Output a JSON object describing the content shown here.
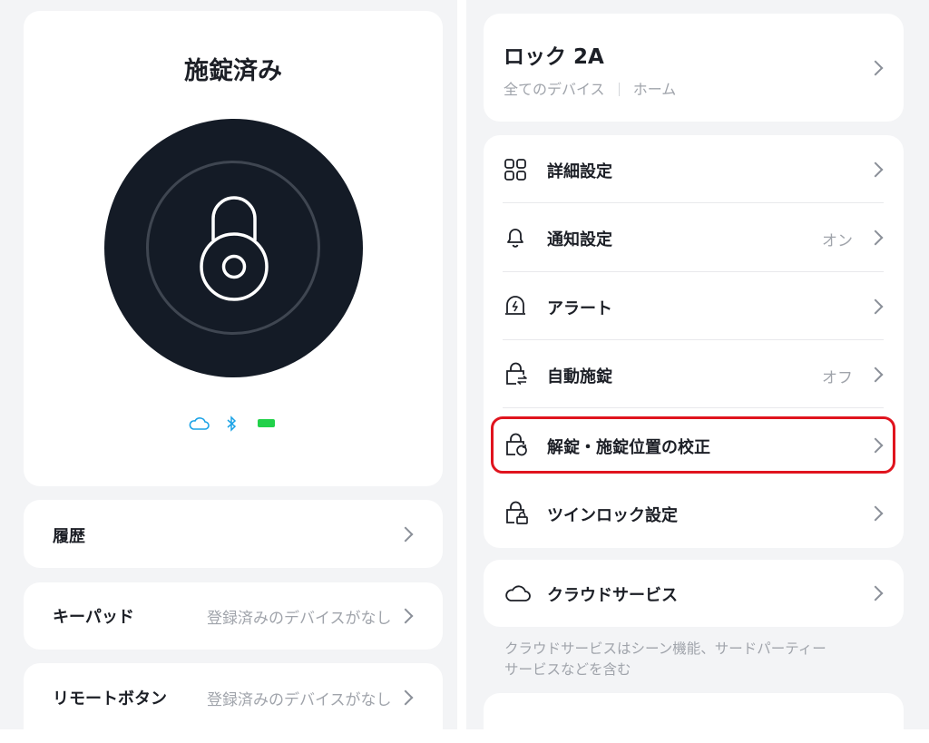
{
  "lock_status": {
    "title": "施錠済み",
    "connectivity_icons": [
      "cloud-icon",
      "bluetooth-icon",
      "battery-icon"
    ],
    "accent_color": "#1aa2e6",
    "battery_color": "#22d14a"
  },
  "left_list": {
    "history": {
      "label": "履歴"
    },
    "keypad": {
      "label": "キーパッド",
      "value": "登録済みのデバイスがなし"
    },
    "remote": {
      "label": "リモートボタン",
      "value": "登録済みのデバイスがなし"
    }
  },
  "device": {
    "name": "ロック 2A",
    "breadcrumb": [
      "全てのデバイス",
      "ホーム"
    ]
  },
  "settings": {
    "items": [
      {
        "label": "詳細設定",
        "value": "",
        "icon": "grid-icon"
      },
      {
        "label": "通知設定",
        "value": "オン",
        "icon": "bell-icon"
      },
      {
        "label": "アラート",
        "value": "",
        "icon": "alarm-icon"
      },
      {
        "label": "自動施錠",
        "value": "オフ",
        "icon": "auto-lock-icon"
      },
      {
        "label": "解錠・施錠位置の校正",
        "value": "",
        "icon": "lock-calibrate-icon",
        "highlighted": true
      },
      {
        "label": "ツインロック設定",
        "value": "",
        "icon": "twin-lock-icon"
      }
    ]
  },
  "cloud": {
    "label": "クラウドサービス",
    "description_line1": "クラウドサービスはシーン機能、サードパーティー",
    "description_line2": "サービスなどを含む"
  },
  "highlight_color": "#e0141e"
}
